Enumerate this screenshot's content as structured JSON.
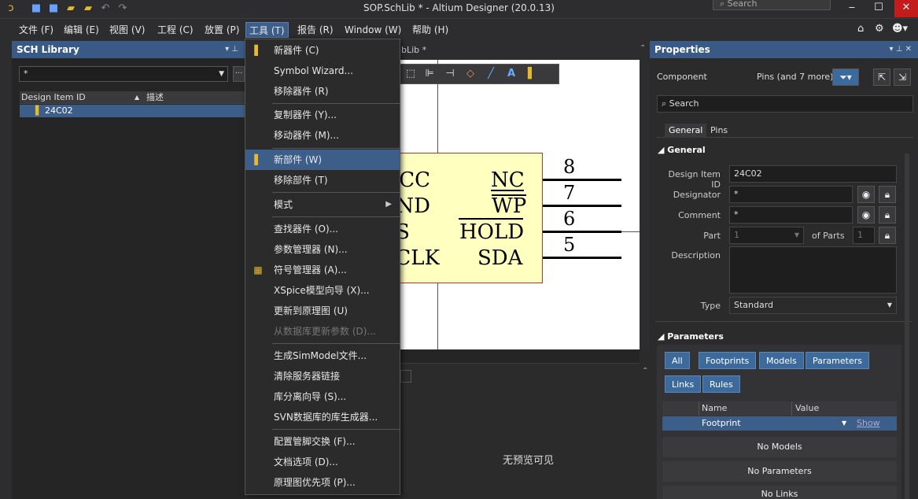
{
  "window": {
    "title": "SOP.SchLib * - Altium Designer (20.0.13)",
    "search_placeholder": "Search"
  },
  "menubar": {
    "items": [
      "文件 (F)",
      "编辑 (E)",
      "视图 (V)",
      "工程 (C)",
      "放置 (P)",
      "工具 (T)",
      "报告 (R)",
      "Window (W)",
      "帮助 (H)"
    ],
    "active_index": 5
  },
  "library_panel": {
    "title": "SCH Library",
    "filter_value": "*",
    "columns": [
      "Design Item ID",
      "描述"
    ],
    "rows": [
      {
        "id": "24C02"
      }
    ]
  },
  "document": {
    "tab_label": "SOP.SchLib *",
    "tab_visible": "bLib *",
    "preview_text": "无预览可见",
    "pins": [
      {
        "num": "8",
        "name": "NC",
        "left_name": "VCC"
      },
      {
        "num": "7",
        "name": "WP",
        "left_name": "GND"
      },
      {
        "num": "6",
        "name": "HOLD",
        "left_name": "CS"
      },
      {
        "num": "5",
        "name": "SDA",
        "left_name": "SCLK"
      }
    ]
  },
  "tools_menu": {
    "items": [
      {
        "label": "新器件 (C)",
        "icon": "component-icon"
      },
      {
        "label": "Symbol Wizard..."
      },
      {
        "label": "移除器件 (R)"
      },
      {
        "label": "复制器件 (Y)..."
      },
      {
        "label": "移动器件 (M)..."
      },
      {
        "label": "新部件 (W)",
        "icon": "part-icon",
        "highlighted": true
      },
      {
        "label": "移除部件 (T)"
      },
      {
        "label": "模式",
        "submenu": true
      },
      {
        "label": "查找器件 (O)..."
      },
      {
        "label": "参数管理器 (N)..."
      },
      {
        "label": "符号管理器 (A)...",
        "icon": "symbol-icon"
      },
      {
        "label": "XSpice模型向导 (X)..."
      },
      {
        "label": "更新到原理图 (U)"
      },
      {
        "label": "从数据库更新参数 (D)...",
        "disabled": true
      },
      {
        "label": "生成SimModel文件..."
      },
      {
        "label": "清除服务器链接"
      },
      {
        "label": "库分离向导 (S)..."
      },
      {
        "label": "SVN数据库的库生成器..."
      },
      {
        "label": "配置管脚交换 (F)..."
      },
      {
        "label": "文档选项 (D)..."
      },
      {
        "label": "原理图优先项 (P)..."
      }
    ]
  },
  "properties": {
    "title": "Properties",
    "component_label": "Component",
    "filter_label": "Pins (and 7 more)",
    "search_placeholder": "Search",
    "tabs": [
      "General",
      "Pins"
    ],
    "general_section": "General",
    "fields": {
      "design_item_id_label": "Design Item ID",
      "design_item_id": "24C02",
      "designator_label": "Designator",
      "designator": "*",
      "comment_label": "Comment",
      "comment": "*",
      "part_label": "Part",
      "part": "1",
      "of_parts_label": "of Parts",
      "of_parts": "1",
      "description_label": "Description",
      "type_label": "Type",
      "type": "Standard"
    },
    "parameters_section": "Parameters",
    "param_filters": [
      "All",
      "Footprints",
      "Models",
      "Parameters",
      "Links",
      "Rules"
    ],
    "grid_columns": [
      "Name",
      "Value"
    ],
    "grid_row": {
      "name": "Footprint",
      "show": "Show"
    },
    "empty_messages": [
      "No Models",
      "No Parameters",
      "No Links"
    ]
  }
}
